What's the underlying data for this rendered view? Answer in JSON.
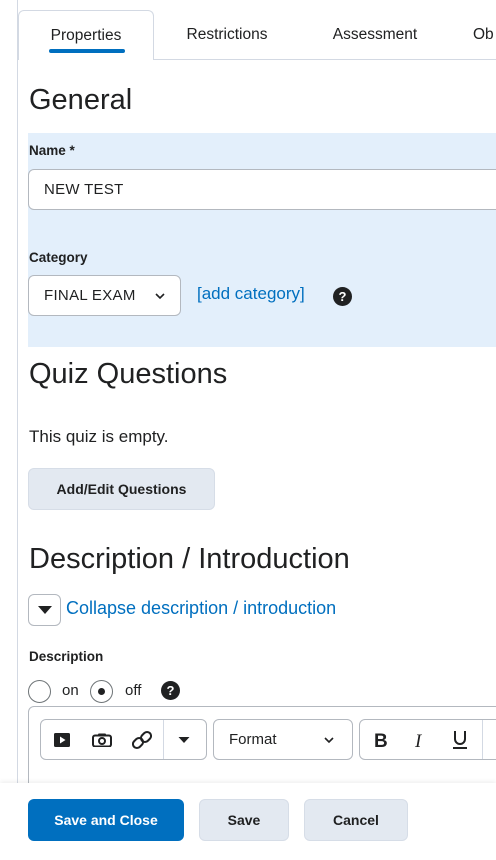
{
  "tabs": [
    {
      "label": "Properties",
      "active": true
    },
    {
      "label": "Restrictions",
      "active": false
    },
    {
      "label": "Assessment",
      "active": false
    },
    {
      "label": "Ob",
      "active": false
    }
  ],
  "general": {
    "heading": "General",
    "name_label": "Name",
    "name_required": "*",
    "name_value": "NEW TEST",
    "category_label": "Category",
    "category_value": "FINAL EXAM",
    "add_category": "[add category]",
    "help": "?"
  },
  "quiz": {
    "heading": "Quiz Questions",
    "empty_text": "This quiz is empty.",
    "add_edit_button": "Add/Edit Questions"
  },
  "description": {
    "heading": "Description / Introduction",
    "collapse_link": "Collapse description / introduction",
    "label": "Description",
    "radio_on": "on",
    "radio_off": "off",
    "selected": "off",
    "help": "?"
  },
  "editor": {
    "format_label": "Format",
    "icons": [
      "video-icon",
      "camera-icon",
      "link-icon",
      "more-dropdown-icon",
      "bold-icon",
      "italic-icon",
      "underline-icon"
    ]
  },
  "footer": {
    "save_close": "Save and Close",
    "save": "Save",
    "cancel": "Cancel"
  },
  "colors": {
    "accent": "#006fbf",
    "panel_bg": "#e3effb",
    "secondary_btn": "#e3e9f1"
  }
}
